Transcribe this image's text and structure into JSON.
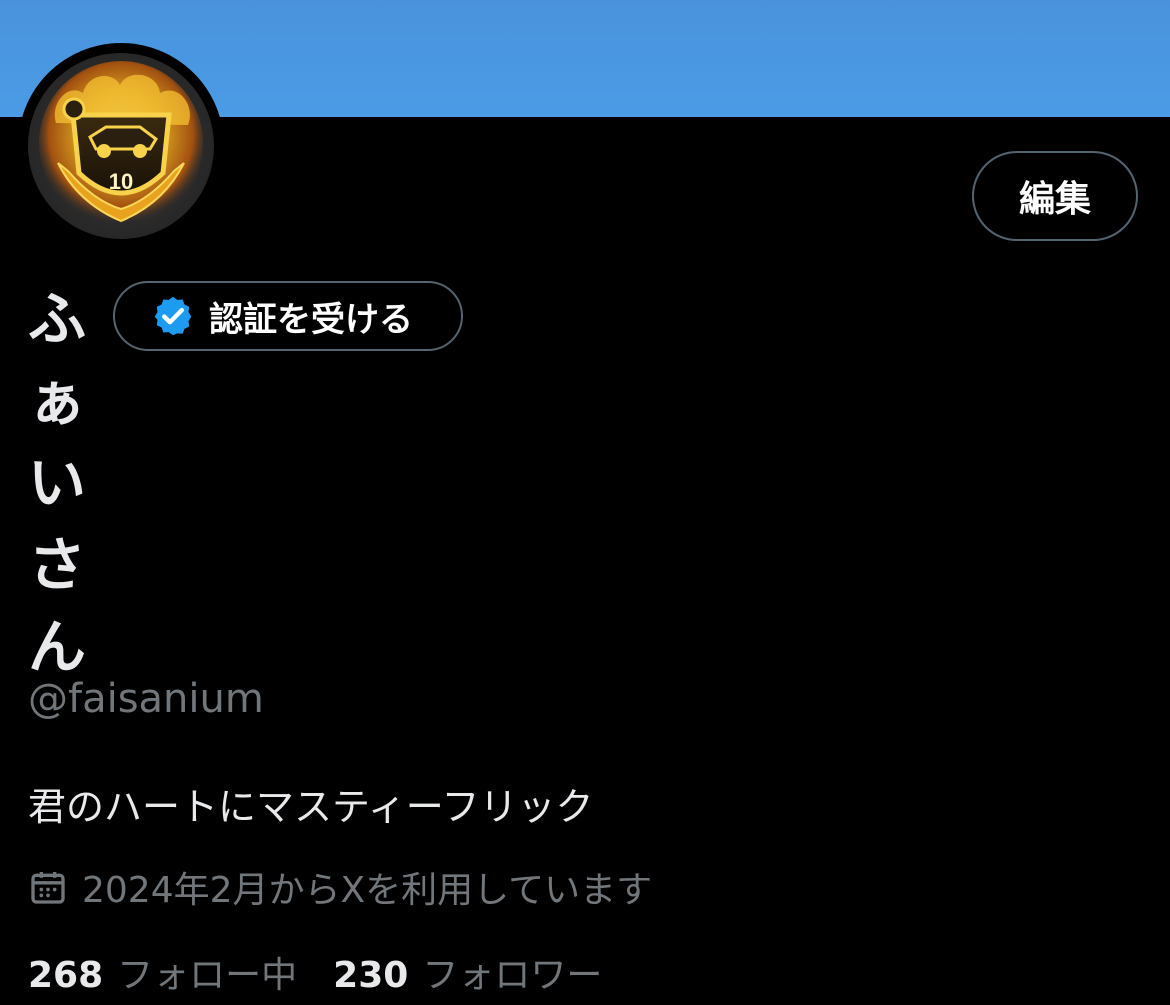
{
  "profile": {
    "display_name": "ふぁいさん",
    "handle": "@faisanium",
    "bio": "君のハートにマスティーフリック",
    "joined": "2024年2月からXを利用しています",
    "avatar_badge_number": "10"
  },
  "buttons": {
    "edit_label": "編集",
    "verify_label": "認証を受ける"
  },
  "stats": {
    "following_count": "268",
    "following_label": "フォロー中",
    "followers_count": "230",
    "followers_label": "フォロワー"
  },
  "icons": {
    "verify_badge": "verified-badge-icon",
    "calendar": "calendar-icon"
  },
  "colors": {
    "banner": "#4b9be6",
    "background": "#000000",
    "accent_blue": "#1d9bf0",
    "muted_text": "#71767b",
    "border": "#536471"
  }
}
